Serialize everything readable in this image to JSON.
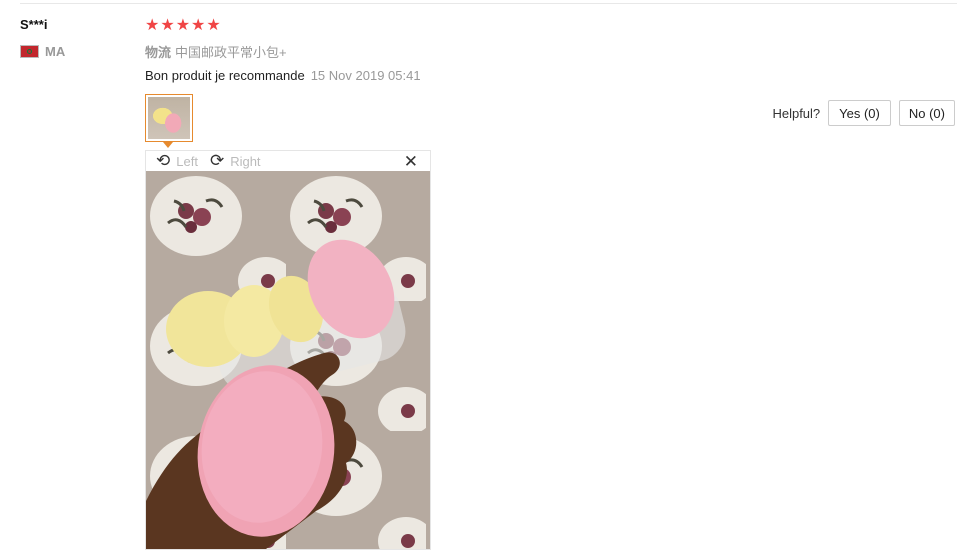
{
  "reviewer": {
    "name": "S***i",
    "country": "MA",
    "flag_icon": "flag-morocco-icon"
  },
  "rating": {
    "stars": 5,
    "max": 5,
    "star_glyph": "★",
    "color": "#f04545"
  },
  "logistics": {
    "label": "物流",
    "value": "中国邮政平常小包+"
  },
  "review": {
    "text": "Bon produit je recommande",
    "date": "15 Nov 2019 05:41"
  },
  "helpful": {
    "label": "Helpful?",
    "yes": "Yes (0)",
    "no": "No (0)"
  },
  "viewer": {
    "rotate_left": "Left",
    "rotate_right": "Right",
    "close_glyph": "✕"
  },
  "colors": {
    "accent": "#e68a2e"
  }
}
